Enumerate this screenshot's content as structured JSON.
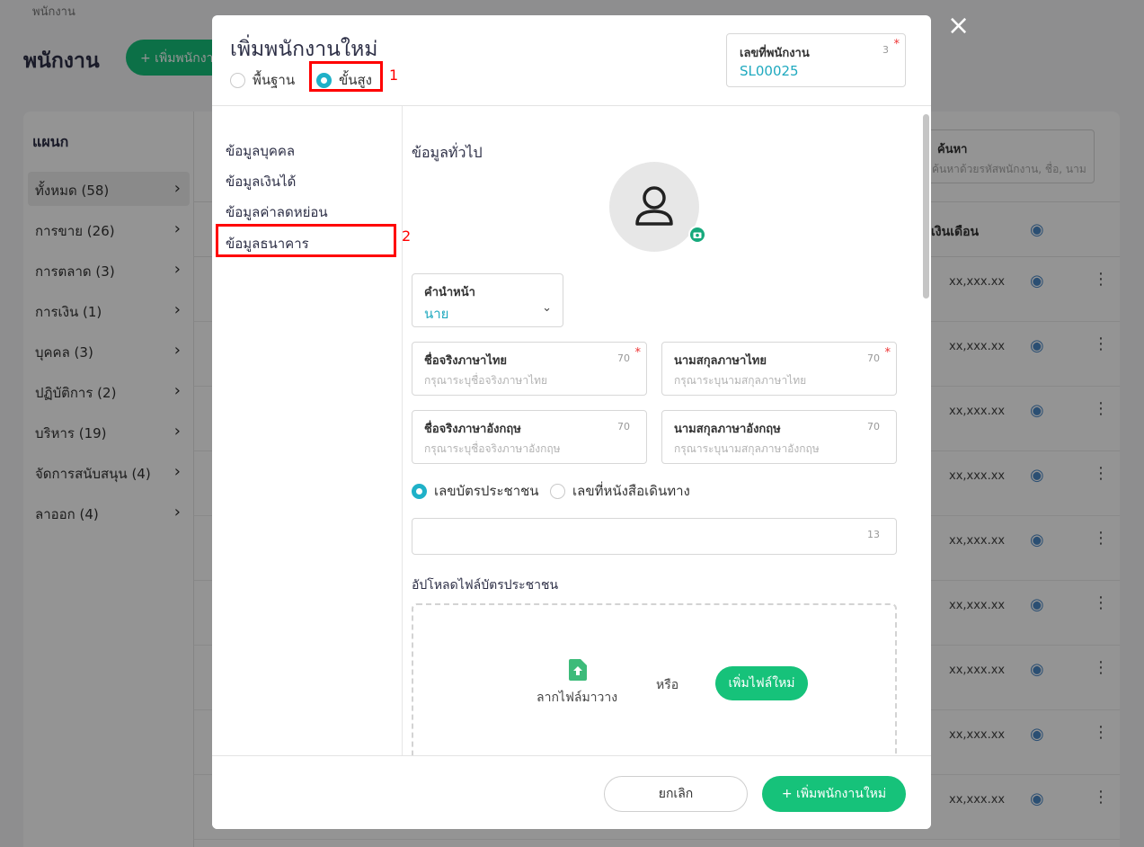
{
  "background": {
    "breadcrumb": "พนักงาน",
    "page_title": "พนักงาน",
    "add_button_label": "+ เพิ่มพนักงาน",
    "sidebar_title": "แผนก",
    "departments": [
      {
        "label": "ทั้งหมด (58)"
      },
      {
        "label": "การขาย (26)"
      },
      {
        "label": "การตลาด (3)"
      },
      {
        "label": "การเงิน (1)"
      },
      {
        "label": "บุคคล (3)"
      },
      {
        "label": "ปฏิบัติการ (2)"
      },
      {
        "label": "บริหาร (19)"
      },
      {
        "label": "จัดการสนับสนุน (4)"
      },
      {
        "label": "ลาออก (4)"
      }
    ],
    "search_label": "ค้นหา",
    "search_placeholder": "ค้นหาด้วยรหัสพนักงาน, ชื่อ, นาม",
    "salary_column": "เงินเดือน",
    "row_value": "xx,xxx.xx"
  },
  "modal": {
    "title": "เพิ่มพนักงานใหม่",
    "mode_basic": "พื้นฐาน",
    "mode_advanced": "ขั้นสูง",
    "annotation_1": "1",
    "annotation_2": "2",
    "employee_no": {
      "label": "เลขที่พนักงาน",
      "count": "3",
      "value": "SL00025",
      "required": "*"
    },
    "nav": [
      {
        "label": "ข้อมูลบุคคล"
      },
      {
        "label": "ข้อมูลเงินได้"
      },
      {
        "label": "ข้อมูลค่าลดหย่อน"
      },
      {
        "label": "ข้อมูลธนาคาร"
      }
    ],
    "section_title": "ข้อมูลทั่วไป",
    "prefix": {
      "label": "คำนำหน้า",
      "value": "นาย"
    },
    "first_name_th": {
      "label": "ชื่อจริงภาษาไทย",
      "count": "70",
      "placeholder": "กรุณาระบุชื่อจริงภาษาไทย",
      "required": "*"
    },
    "last_name_th": {
      "label": "นามสกุลภาษาไทย",
      "count": "70",
      "placeholder": "กรุณาระบุนามสกุลภาษาไทย",
      "required": "*"
    },
    "first_name_en": {
      "label": "ชื่อจริงภาษาอังกฤษ",
      "count": "70",
      "placeholder": "กรุณาระบุชื่อจริงภาษาอังกฤษ"
    },
    "last_name_en": {
      "label": "นามสกุลภาษาอังกฤษ",
      "count": "70",
      "placeholder": "กรุณาระบุนามสกุลภาษาอังกฤษ"
    },
    "id_type_citizen": "เลขบัตรประชาชน",
    "id_type_passport": "เลขที่หนังสือเดินทาง",
    "id_number_count": "13",
    "upload_title": "อัปโหลดไฟล์บัตรประชาชน",
    "drop_text": "ลากไฟล์มาวาง",
    "or_text": "หรือ",
    "add_file_label": "เพิ่มไฟล์ใหม่",
    "cancel_label": "ยกเลิก",
    "submit_label": "+ เพิ่มพนักงานใหม่",
    "close_icon": "×"
  },
  "colors": {
    "accent": "#16c27a",
    "teal": "#1fb1c8",
    "highlight": "#ff0000"
  }
}
